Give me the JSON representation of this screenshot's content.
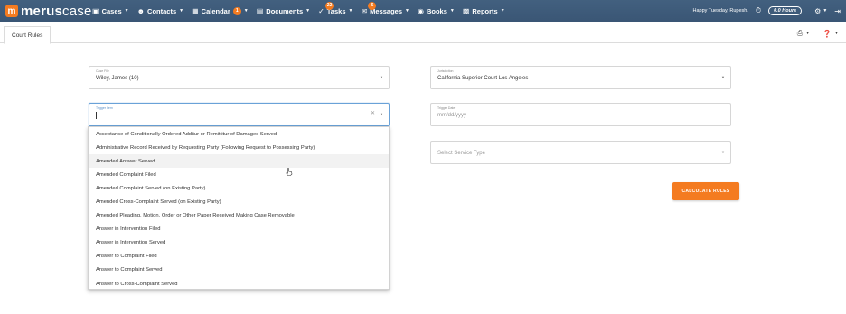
{
  "app": {
    "logo_letter": "m",
    "logo_bold": "merus",
    "logo_light": "case"
  },
  "nav": {
    "items": [
      {
        "label": "Cases",
        "icon": "briefcase-icon"
      },
      {
        "label": "Contacts",
        "icon": "contacts-icon"
      },
      {
        "label": "Calendar",
        "icon": "calendar-icon",
        "badge": "1"
      },
      {
        "label": "Documents",
        "icon": "documents-icon"
      },
      {
        "label": "Tasks",
        "icon": "tasks-icon",
        "badge": "22"
      },
      {
        "label": "Messages",
        "icon": "messages-icon",
        "badge": "6"
      },
      {
        "label": "Books",
        "icon": "books-icon"
      },
      {
        "label": "Reports",
        "icon": "reports-icon"
      }
    ],
    "greeting": "Happy Tuesday, Rupesh.",
    "timer": "0.0 Hours"
  },
  "tabs": {
    "active": "Court Rules"
  },
  "form": {
    "case_file": {
      "label": "Case File",
      "value": "Wiley, James (10)"
    },
    "jurisdiction": {
      "label": "Jurisdiction",
      "value": "California Superior Court Los Angeles"
    },
    "trigger_item": {
      "label": "Trigger Item",
      "value": ""
    },
    "trigger_date": {
      "label": "Trigger Date",
      "placeholder": "mm/dd/yyyy"
    },
    "service_type": {
      "placeholder": "Select Service Type"
    },
    "calculate_label": "CALCULATE RULES"
  },
  "dropdown": {
    "hover_index": 2,
    "options": [
      "Acceptance of Conditionally Ordered Additur or Remittitur of Damages Served",
      "Administrative Record Received by Requesting Party (Following Request to Possessing Party)",
      "Amended Answer Served",
      "Amended Complaint Filed",
      "Amended Complaint Served (on Existing Party)",
      "Amended Cross-Complaint Served (on Existing Party)",
      "Amended Pleading, Motion, Order or Other Paper Received Making Case Removable",
      "Answer in Intervention Filed",
      "Answer in Intervention Served",
      "Answer to Complaint Filed",
      "Answer to Complaint Served",
      "Answer to Cross-Complaint Served"
    ]
  },
  "colors": {
    "nav_bg": "#3d5a7c",
    "accent": "#f47b20",
    "focus": "#6aa2d8"
  }
}
